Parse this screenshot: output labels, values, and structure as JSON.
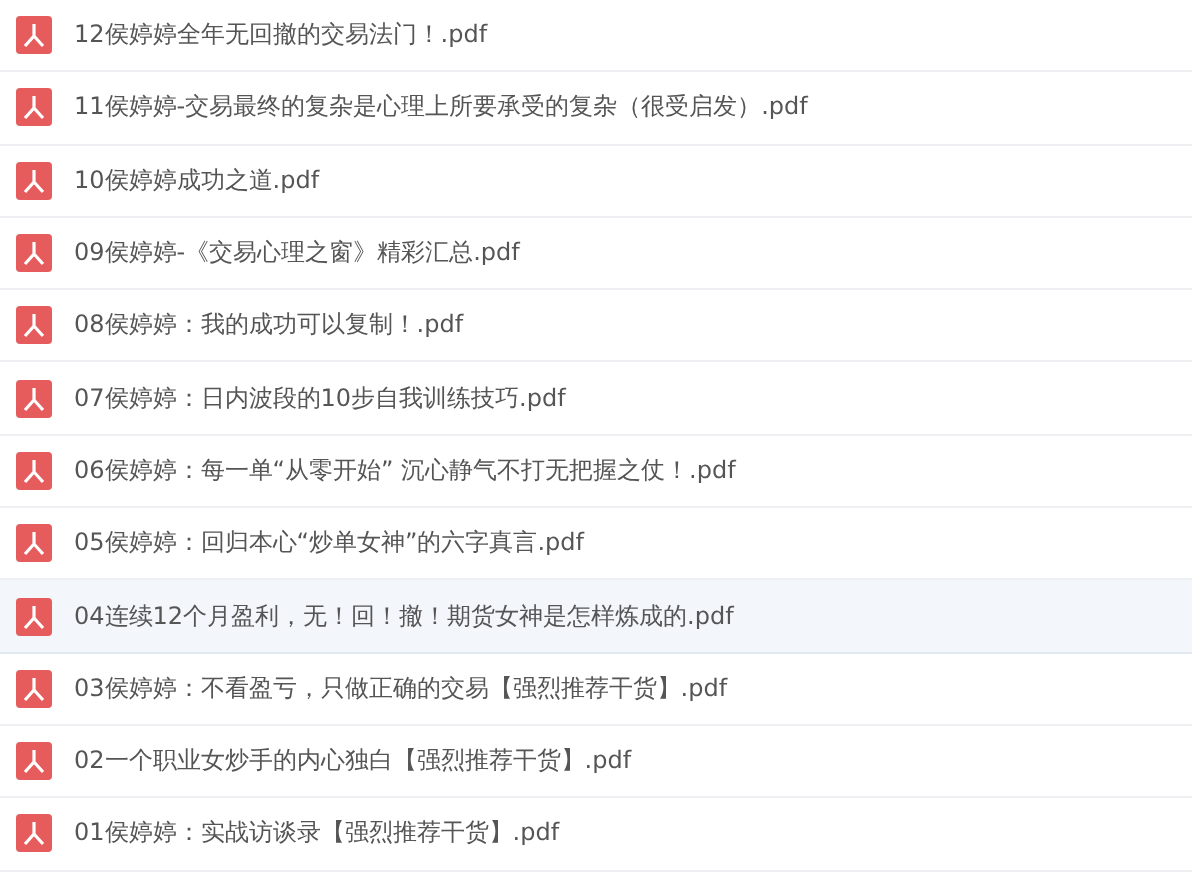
{
  "files": [
    {
      "name": "12侯婷婷全年无回撤的交易法门！.pdf",
      "selected": false
    },
    {
      "name": "11侯婷婷-交易最终的复杂是心理上所要承受的复杂（很受启发）.pdf",
      "selected": false
    },
    {
      "name": "10侯婷婷成功之道.pdf",
      "selected": false
    },
    {
      "name": "09侯婷婷-《交易心理之窗》精彩汇总.pdf",
      "selected": false
    },
    {
      "name": "08侯婷婷：我的成功可以复制！.pdf",
      "selected": false
    },
    {
      "name": "07侯婷婷：日内波段的10步自我训练技巧.pdf",
      "selected": false
    },
    {
      "name": "06侯婷婷：每一单“从零开始” 沉心静气不打无把握之仗！.pdf",
      "selected": false
    },
    {
      "name": "05侯婷婷：回归本心“炒单女神”的六字真言.pdf",
      "selected": false
    },
    {
      "name": "04连续12个月盈利，无！回！撤！期货女神是怎样炼成的.pdf",
      "selected": true
    },
    {
      "name": "03侯婷婷：不看盈亏，只做正确的交易【强烈推荐干货】.pdf",
      "selected": false
    },
    {
      "name": "02一个职业女炒手的内心独白【强烈推荐干货】.pdf",
      "selected": false
    },
    {
      "name": "01侯婷婷：实战访谈录【强烈推荐干货】.pdf",
      "selected": false
    }
  ]
}
